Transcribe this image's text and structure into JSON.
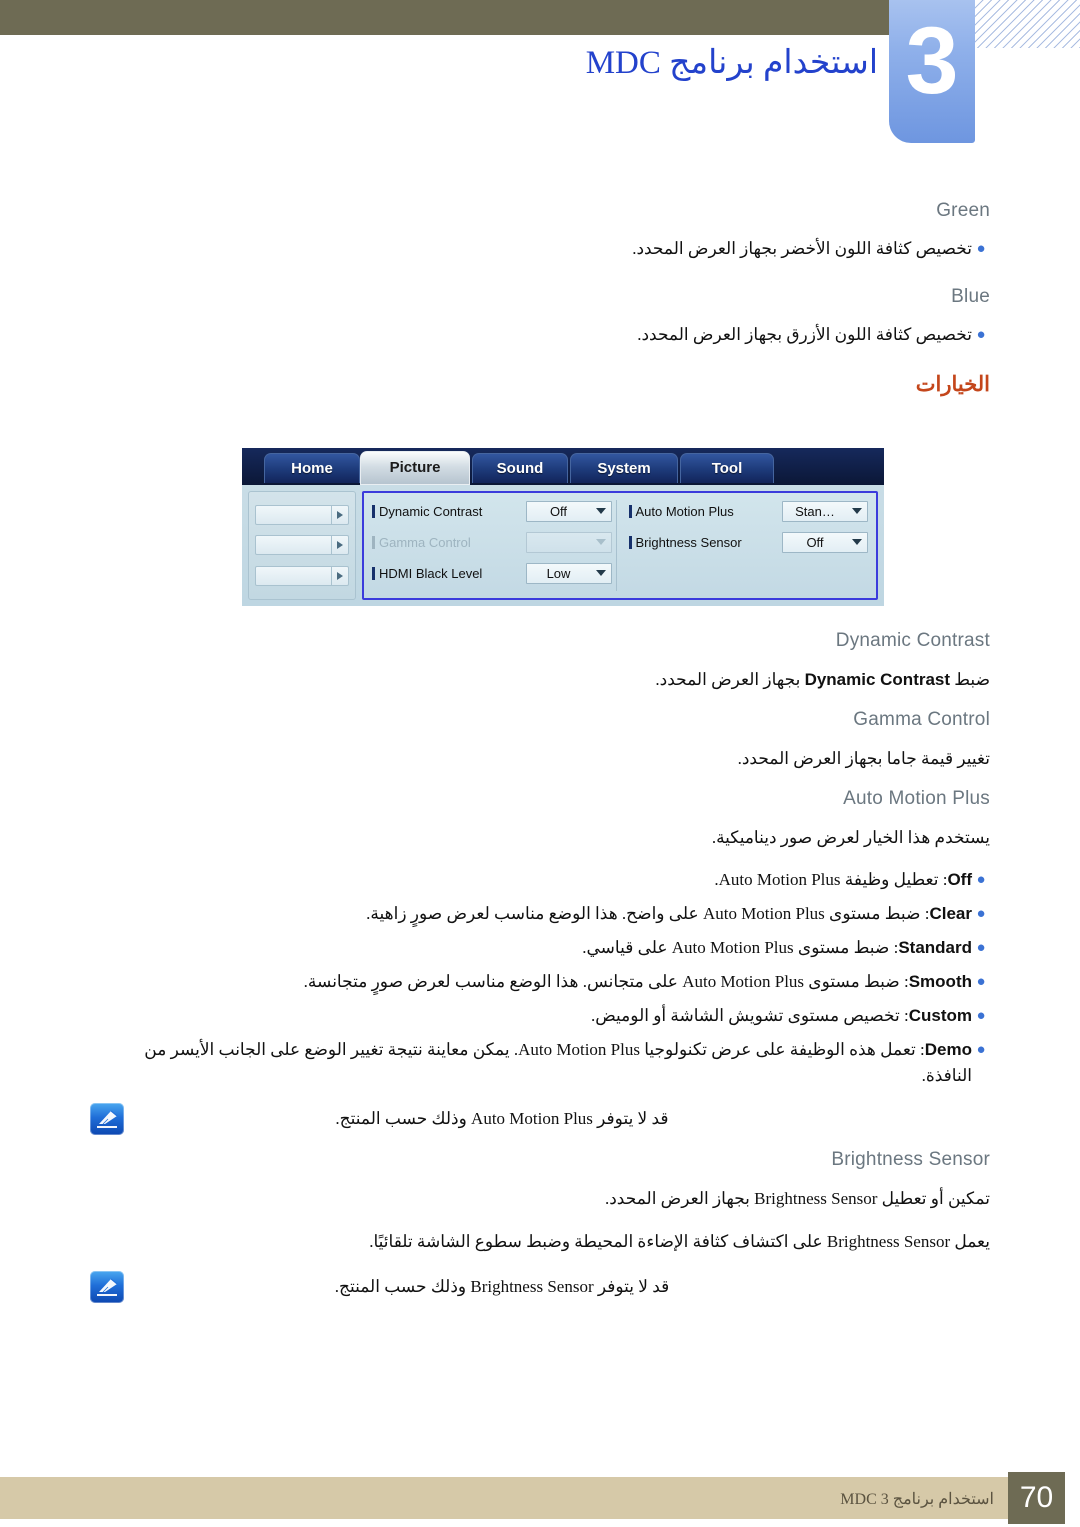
{
  "header": {
    "chapter_number": "3",
    "title": "استخدام برنامج MDC"
  },
  "colors": {
    "header_bar": "#6e6b54",
    "chapter_block": "#8fb0ea",
    "title_blue": "#2342cc",
    "orange_heading": "#c4461b",
    "footer_bar": "#d6c9a8",
    "footer_page_box": "#6e6b54",
    "bullet_blue": "#3b72d4",
    "subhead_gray": "#6b7780",
    "dialog_focus_border": "#3b3bdc"
  },
  "sections": {
    "green": {
      "heading": "Green",
      "bullet": "تخصيص كثافة اللون الأخضر بجهاز العرض المحدد."
    },
    "blue": {
      "heading": "Blue",
      "bullet": "تخصيص كثافة اللون الأزرق بجهاز العرض المحدد."
    },
    "options_heading": "الخيارات",
    "dynamic_contrast": {
      "heading": "Dynamic Contrast",
      "text_before": "ضبط ",
      "term": "Dynamic Contrast",
      "text_after": " بجهاز العرض المحدد."
    },
    "gamma_control": {
      "heading": "Gamma Control",
      "text": "تغيير قيمة جاما بجهاز العرض المحدد."
    },
    "auto_motion_plus": {
      "heading": "Auto Motion Plus",
      "intro": "يستخدم هذا الخيار لعرض صور ديناميكية.",
      "items": [
        {
          "term": "Off",
          "desc": ": تعطيل وظيفة Auto Motion Plus."
        },
        {
          "term": "Clear",
          "desc": ": ضبط مستوى Auto Motion Plus على واضح. هذا الوضع مناسب لعرض صورٍ زاهية."
        },
        {
          "term": "Standard",
          "desc": ": ضبط مستوى Auto Motion Plus على قياسي."
        },
        {
          "term": "Smooth",
          "desc": ": ضبط مستوى Auto Motion Plus على متجانس. هذا الوضع مناسب لعرض صورٍ متجانسة."
        },
        {
          "term": "Custom",
          "desc": ": تخصيص مستوى تشويش الشاشة أو الوميض."
        },
        {
          "term": "Demo",
          "desc": ": تعمل هذه الوظيفة على عرض تكنولوجيا Auto Motion Plus. يمكن معاينة نتيجة تغيير الوضع على الجانب الأيسر من النافذة."
        }
      ],
      "note": "قد لا يتوفر Auto Motion Plus وذلك حسب المنتج."
    },
    "brightness_sensor": {
      "heading": "Brightness Sensor",
      "line1": "تمكين أو تعطيل Brightness Sensor بجهاز العرض المحدد.",
      "line2": "يعمل Brightness Sensor على اكتشاف كثافة الإضاءة المحيطة وضبط سطوع الشاشة تلقائيًا.",
      "note": "قد لا يتوفر Brightness Sensor وذلك حسب المنتج."
    }
  },
  "mdc_dialog": {
    "tabs": [
      {
        "label": "Home",
        "active": false
      },
      {
        "label": "Picture",
        "active": true
      },
      {
        "label": "Sound",
        "active": false
      },
      {
        "label": "System",
        "active": false
      },
      {
        "label": "Tool",
        "active": false
      }
    ],
    "left_panel": {
      "combo_count": 3,
      "combos": [
        "",
        "",
        ""
      ]
    },
    "fields": [
      {
        "label": "Dynamic Contrast",
        "value": "Off",
        "disabled": false
      },
      {
        "label": "Gamma Control",
        "value": "",
        "disabled": true
      },
      {
        "label": "HDMI Black Level",
        "value": "Low",
        "disabled": false
      },
      {
        "label": "Auto Motion Plus",
        "value": "Stan…",
        "disabled": false
      },
      {
        "label": "Brightness Sensor",
        "value": "Off",
        "disabled": false
      }
    ]
  },
  "footer": {
    "text": "استخدام برنامج MDC 3",
    "page_number": "70"
  }
}
